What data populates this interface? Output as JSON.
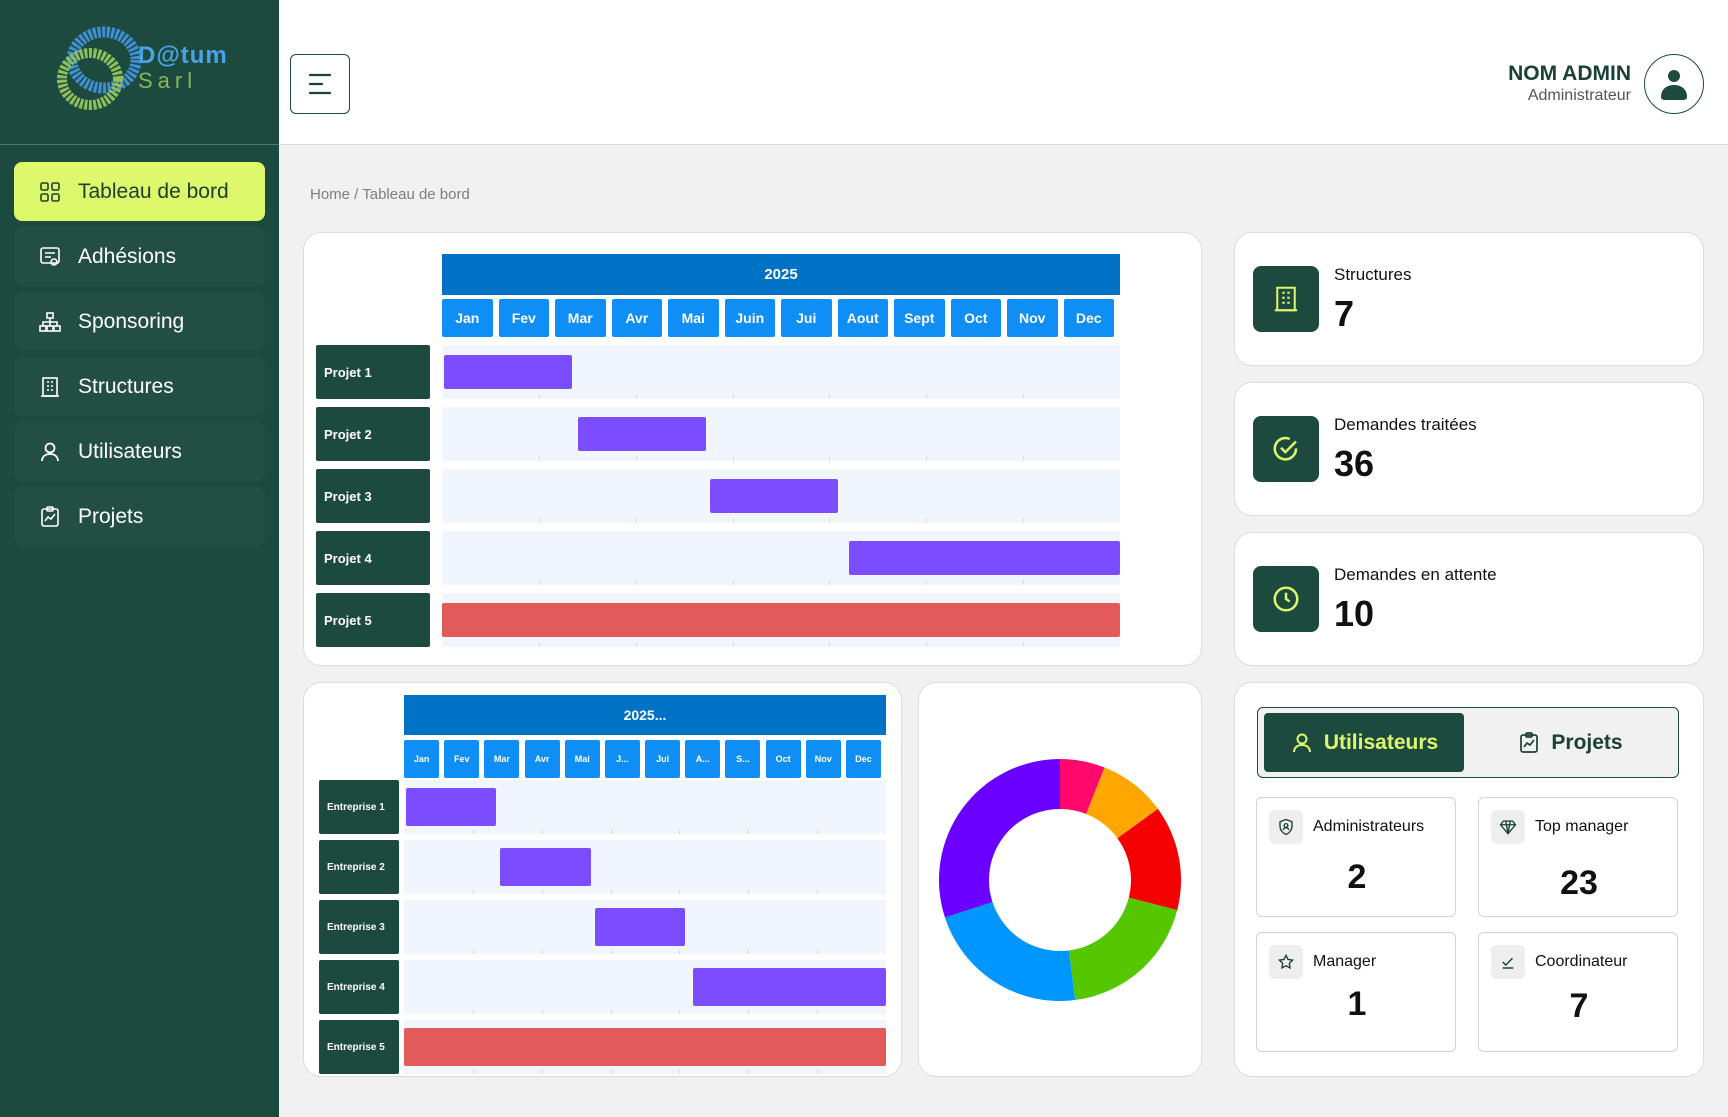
{
  "brand": {
    "line1": "D@tum",
    "line2": "Sarl"
  },
  "sidebar": {
    "items": [
      {
        "label": "Tableau de bord",
        "icon": "grid-icon",
        "active": true
      },
      {
        "label": "Adhésions",
        "icon": "membership-icon",
        "active": false
      },
      {
        "label": "Sponsoring",
        "icon": "hierarchy-icon",
        "active": false
      },
      {
        "label": "Structures",
        "icon": "building-icon",
        "active": false
      },
      {
        "label": "Utilisateurs",
        "icon": "user-icon",
        "active": false
      },
      {
        "label": "Projets",
        "icon": "clipboard-chart-icon",
        "active": false
      }
    ]
  },
  "header": {
    "admin_name": "NOM ADMIN",
    "admin_role": "Administrateur"
  },
  "breadcrumb": "Home / Tableau de bord",
  "gantt_projects": {
    "title": "2025",
    "months": [
      "Jan",
      "Fev",
      "Mar",
      "Avr",
      "Mai",
      "Juin",
      "Jui",
      "Aout",
      "Sept",
      "Oct",
      "Nov",
      "Dec"
    ],
    "rows": [
      {
        "label": "Projet 1",
        "start": 0,
        "end": 2.3,
        "color": "#7c4dff"
      },
      {
        "label": "Projet 2",
        "start": 2.4,
        "end": 4.7,
        "color": "#7c4dff"
      },
      {
        "label": "Projet 3",
        "start": 4.75,
        "end": 7.05,
        "color": "#7c4dff"
      },
      {
        "label": "Projet 4",
        "start": 7.2,
        "end": 12,
        "color": "#7c4dff"
      },
      {
        "label": "Projet 5",
        "start": 0,
        "end": 12,
        "color": "#e35a5a"
      }
    ]
  },
  "gantt_entreprises": {
    "title": "2025...",
    "months": [
      "Jan",
      "Fev",
      "Mar",
      "Avr",
      "Mai",
      "J...",
      "Jui",
      "A...",
      "S...",
      "Oct",
      "Nov",
      "Dec"
    ],
    "rows": [
      {
        "label": "Entreprise 1",
        "start": 0,
        "end": 2.3,
        "color": "#7c4dff"
      },
      {
        "label": "Entreprise 2",
        "start": 2.4,
        "end": 4.7,
        "color": "#7c4dff"
      },
      {
        "label": "Entreprise 3",
        "start": 4.75,
        "end": 7.05,
        "color": "#7c4dff"
      },
      {
        "label": "Entreprise 4",
        "start": 7.2,
        "end": 12,
        "color": "#7c4dff"
      },
      {
        "label": "Entreprise 5",
        "start": 0,
        "end": 12,
        "color": "#e35a5a"
      }
    ]
  },
  "stats": [
    {
      "label": "Structures",
      "value": "7",
      "icon": "building-icon"
    },
    {
      "label": "Demandes traitées",
      "value": "36",
      "icon": "check-circle-icon"
    },
    {
      "label": "Demandes en attente",
      "value": "10",
      "icon": "clock-icon"
    }
  ],
  "chart_data": {
    "type": "pie",
    "donut": true,
    "values": [
      6,
      9,
      14,
      19,
      22,
      30
    ],
    "colors": [
      "#ff0a6c",
      "#ffa600",
      "#f40000",
      "#55c700",
      "#0096ff",
      "#6a00ff"
    ]
  },
  "tabs": {
    "users": "Utilisateurs",
    "projects": "Projets"
  },
  "roles": [
    {
      "label": "Administrateurs",
      "value": "2",
      "icon": "shield-user-icon"
    },
    {
      "label": "Top manager",
      "value": "23",
      "icon": "diamond-icon"
    },
    {
      "label": "Manager",
      "value": "1",
      "icon": "star-icon"
    },
    {
      "label": "Coordinateur",
      "value": "7",
      "icon": "check-list-icon"
    }
  ]
}
